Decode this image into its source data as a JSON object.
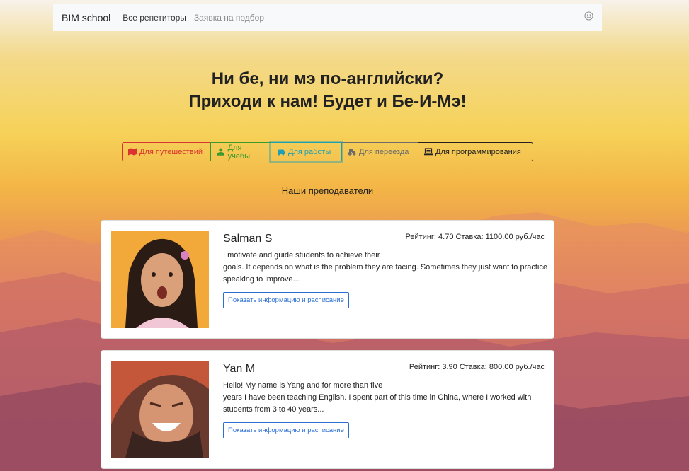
{
  "navbar": {
    "brand": "BIM school",
    "links": [
      {
        "label": "Все репетиторы",
        "active": true
      },
      {
        "label": "Заявка на подбор",
        "active": false
      }
    ],
    "user_icon": "smile-icon"
  },
  "hero": {
    "line1": "Ни бе, ни мэ по-английски?",
    "line2": "Приходи к нам! Будет и Бе-И-Мэ!"
  },
  "filters": [
    {
      "label": "Для путешествий",
      "icon": "map-icon",
      "color": "#d9342f"
    },
    {
      "label": "Для учебы",
      "icon": "school-icon",
      "color": "#3a9a2c"
    },
    {
      "label": "Для работы",
      "icon": "car-icon",
      "color": "#1e9fb4",
      "selected": true
    },
    {
      "label": "Для переезда",
      "icon": "tractor-icon",
      "color": "#6c6c6c"
    },
    {
      "label": "Для программирования",
      "icon": "laptop-icon",
      "color": "#222222"
    }
  ],
  "section_title": "Наши преподаватели",
  "teachers": [
    {
      "name": "Salman S",
      "rating_text": "Рейтинг: 4.70 Ставка: 1100.00 руб./час",
      "desc_line1": "I motivate and guide students to achieve their",
      "desc_rest": "goals. It depends on what is the problem they are facing. Sometimes they just want to practice speaking to improve...",
      "button": "Показать информацию и расписание"
    },
    {
      "name": "Yan M",
      "rating_text": "Рейтинг: 3.90 Ставка: 800.00 руб./час",
      "desc_line1": "Hello! My name is Yang and for more than five",
      "desc_rest": "years I have been teaching English. I spent part of this time in China, where I worked with students from 3 to 40 years...",
      "button": "Показать информацию и расписание"
    }
  ]
}
